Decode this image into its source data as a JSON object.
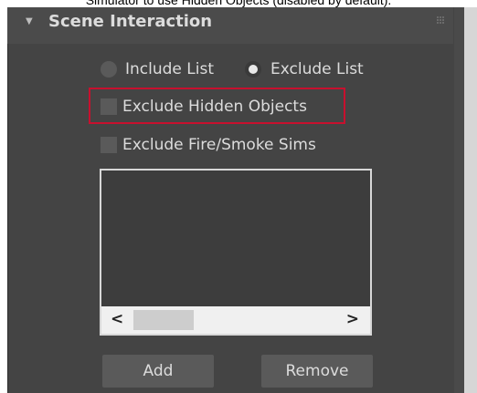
{
  "caption": "Simulator to use Hidden Objects (disabled by default).",
  "rollout": {
    "title": "Scene Interaction"
  },
  "radios": [
    {
      "label": "Include List",
      "selected": false
    },
    {
      "label": "Exclude List",
      "selected": true
    }
  ],
  "checkboxes": [
    {
      "label": "Exclude Hidden Objects",
      "checked": false
    },
    {
      "label": "Exclude Fire/Smoke Sims",
      "checked": false
    }
  ],
  "list": {
    "items": []
  },
  "buttons": {
    "add_label": "Add",
    "remove_label": "Remove"
  },
  "colors": {
    "panel_bg": "#444444",
    "highlight": "#c8102e"
  }
}
